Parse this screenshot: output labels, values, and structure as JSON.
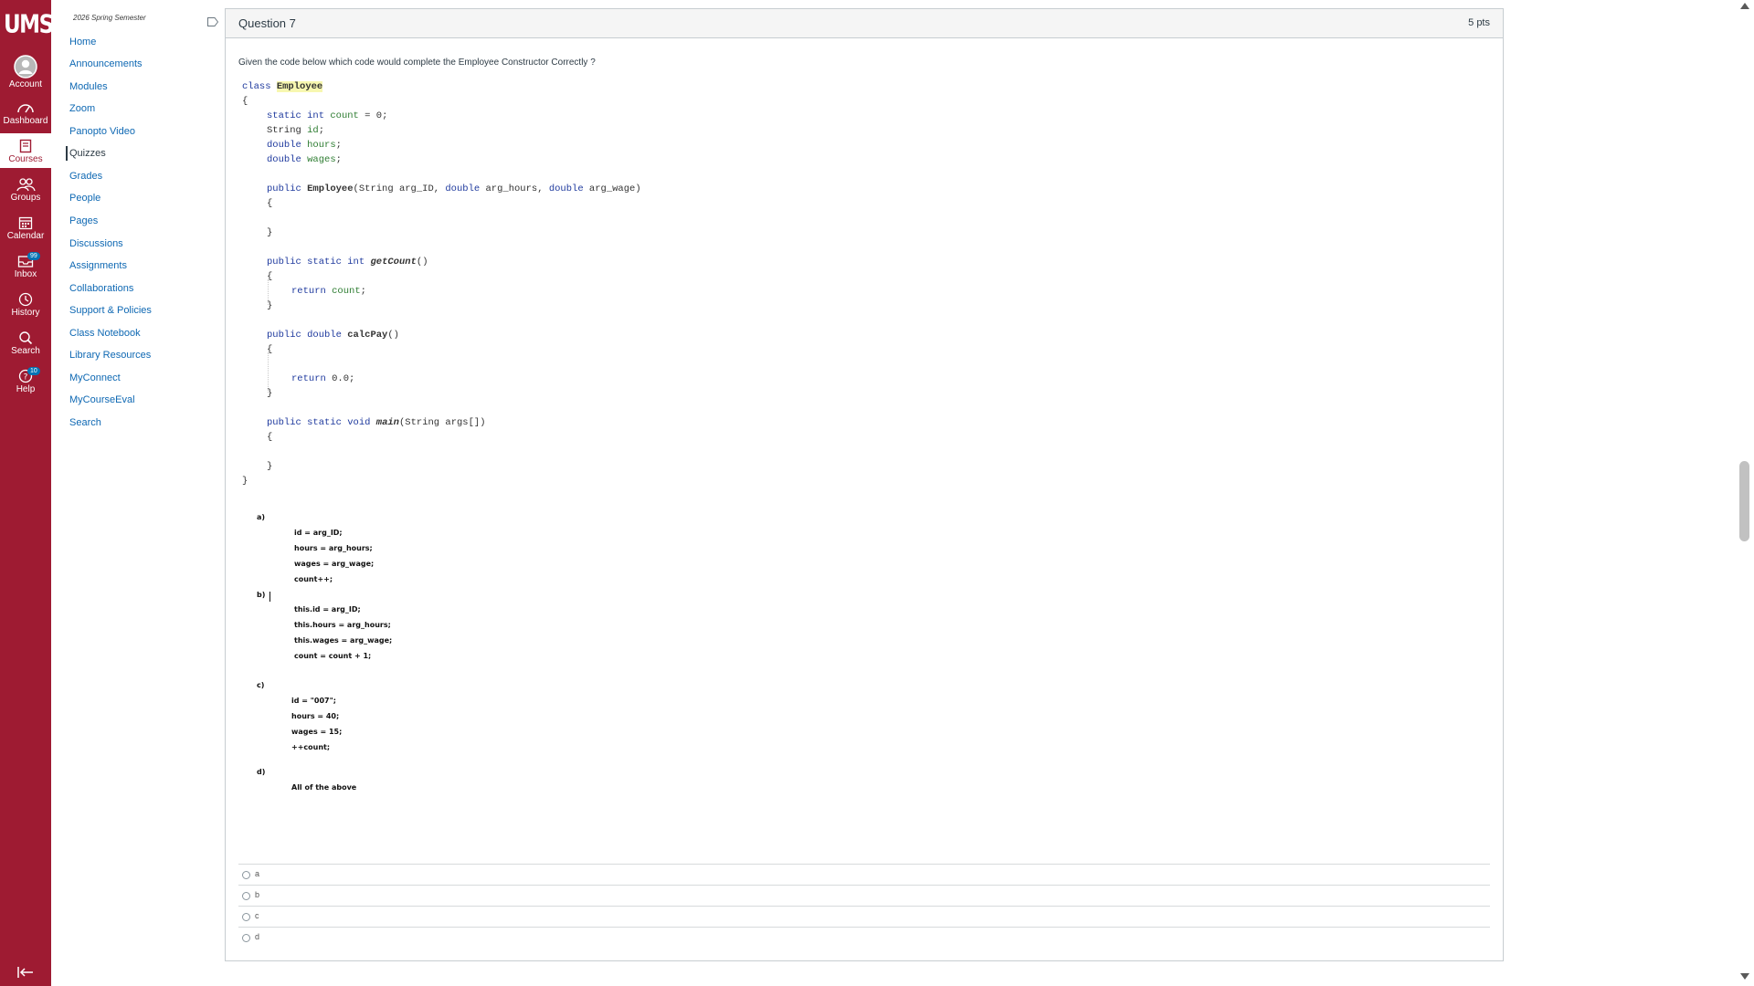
{
  "global_nav": {
    "logo": "UMSL",
    "items": [
      {
        "label": "Account",
        "icon": "avatar-icon"
      },
      {
        "label": "Dashboard",
        "icon": "dashboard-icon"
      },
      {
        "label": "Courses",
        "icon": "courses-icon"
      },
      {
        "label": "Groups",
        "icon": "groups-icon"
      },
      {
        "label": "Calendar",
        "icon": "calendar-icon"
      },
      {
        "label": "Inbox",
        "icon": "inbox-icon",
        "badge": "99"
      },
      {
        "label": "History",
        "icon": "history-icon"
      },
      {
        "label": "Search",
        "icon": "search-icon"
      },
      {
        "label": "Help",
        "icon": "help-icon",
        "badge": "10"
      }
    ],
    "brand_color": "#9e1b32"
  },
  "course_nav": {
    "term": "2026 Spring Semester",
    "items": [
      "Home",
      "Announcements",
      "Modules",
      "Zoom",
      "Panopto Video",
      "Quizzes",
      "Grades",
      "People",
      "Pages",
      "Discussions",
      "Assignments",
      "Collaborations",
      "Support & Policies",
      "Class Notebook",
      "Library Resources",
      "MyConnect",
      "MyCourseEval",
      "Search"
    ],
    "active": "Quizzes"
  },
  "question": {
    "title": "Question 7",
    "points": "5 pts",
    "prompt": "Given the code below which code would complete the Employee Constructor Correctly ?",
    "code": {
      "class_kw": "class",
      "class_name": "Employee",
      "static_kw": "static",
      "int_kw": "int",
      "count_field": "count",
      "count_init": " = 0;",
      "string_type": "String",
      "id_field": "id",
      "double_kw": "double",
      "hours_field": "hours",
      "wages_field": "wages",
      "public_kw": "public",
      "ctor_name": "Employee",
      "ctor_params_1": "(String arg_ID, ",
      "ctor_params_2": " arg_hours, ",
      "ctor_params_3": " arg_wage)",
      "getcount_name": "getCount",
      "return_kw": "return",
      "calcpay_name": "calcPay",
      "return_val": " 0.0;",
      "void_kw": "void",
      "main_name": "main",
      "main_params": "(String args[])",
      "open_brace": "{",
      "close_brace": "}",
      "empty_parens": "()",
      "semicolon": ";"
    },
    "options": [
      {
        "letter": "a)",
        "lines": [
          "id = arg_ID;",
          "hours = arg_hours;",
          "wages = arg_wage;",
          "count++;"
        ]
      },
      {
        "letter": "b)",
        "lines": [
          "this.id = arg_ID;",
          "this.hours = arg_hours;",
          "this.wages = arg_wage;",
          "count = count + 1;"
        ]
      },
      {
        "letter": "c)",
        "lines": [
          "id = \"007\";",
          "hours = 40;",
          "wages = 15;",
          "++count;"
        ]
      },
      {
        "letter": "d)",
        "lines": [
          "All of the above"
        ]
      }
    ],
    "answers": [
      "a",
      "b",
      "c",
      "d"
    ]
  }
}
